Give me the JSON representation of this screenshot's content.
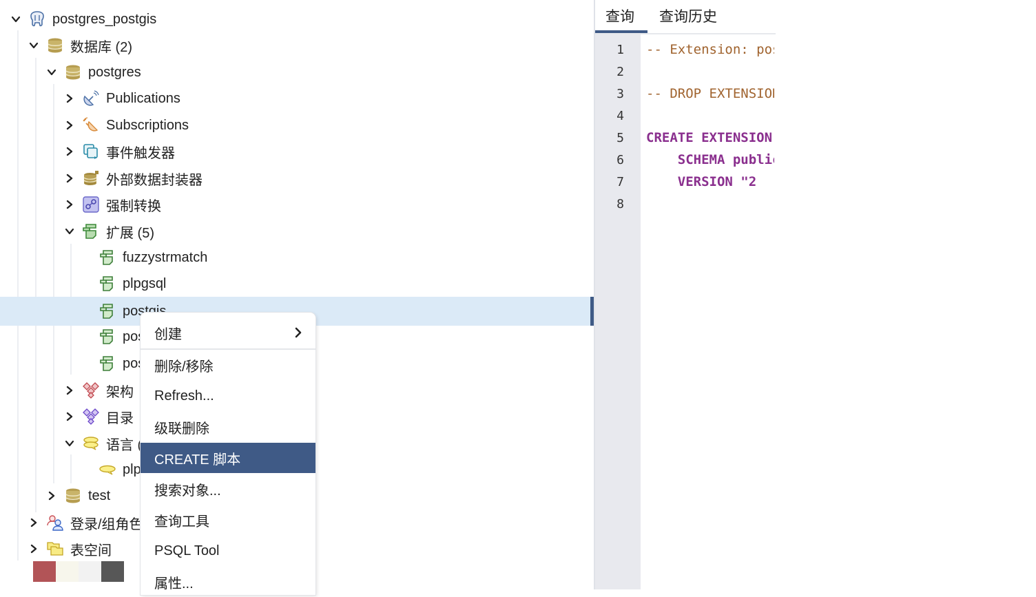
{
  "tree": {
    "items": [
      {
        "label": "postgres_postgis",
        "icon": "postgres-elephant-icon",
        "expanded": true
      },
      {
        "label": "数据库 (2)",
        "icon": "databases-icon",
        "expanded": true
      },
      {
        "label": "postgres",
        "icon": "database-icon",
        "expanded": true
      },
      {
        "label": "Publications",
        "icon": "publication-icon",
        "expanded": false
      },
      {
        "label": "Subscriptions",
        "icon": "subscription-icon",
        "expanded": false
      },
      {
        "label": "事件触发器",
        "icon": "event-trigger-icon",
        "expanded": false
      },
      {
        "label": "外部数据封装器",
        "icon": "foreign-data-wrapper-icon",
        "expanded": false
      },
      {
        "label": "强制转换",
        "icon": "cast-icon",
        "expanded": false
      },
      {
        "label": "扩展 (5)",
        "icon": "extensions-icon",
        "expanded": true
      },
      {
        "label": "fuzzystrmatch",
        "icon": "extension-icon"
      },
      {
        "label": "plpgsql",
        "icon": "extension-icon"
      },
      {
        "label": "postgis",
        "icon": "extension-icon",
        "selected": true
      },
      {
        "label": "pos",
        "icon": "extension-icon"
      },
      {
        "label": "pos",
        "icon": "extension-icon"
      },
      {
        "label": "架构",
        "icon": "schema-icon",
        "expanded": false
      },
      {
        "label": "目录",
        "icon": "catalog-icon",
        "expanded": false
      },
      {
        "label": "语言 (",
        "icon": "languages-icon",
        "expanded": true
      },
      {
        "label": "plp",
        "icon": "language-icon"
      },
      {
        "label": "test",
        "icon": "database-icon",
        "expanded": false
      },
      {
        "label": "登录/组角色",
        "icon": "login-roles-icon",
        "expanded": false
      },
      {
        "label": "表空间",
        "icon": "tablespaces-icon",
        "expanded": false
      }
    ],
    "swatches": [
      "#b25457",
      "#f7f6ec",
      "#f2f2f2",
      "#575757"
    ]
  },
  "query_panel": {
    "tabs": [
      {
        "label": "查询",
        "active": true
      },
      {
        "label": "查询历史",
        "active": false
      }
    ],
    "lines": [
      {
        "n": "1",
        "text": "-- Extension: postgis",
        "kind": "comment"
      },
      {
        "n": "2",
        "text": "",
        "kind": "plain"
      },
      {
        "n": "3",
        "text": "-- DROP EXTENSION postgis;",
        "kind": "comment"
      },
      {
        "n": "4",
        "text": "",
        "kind": "plain"
      },
      {
        "n": "5",
        "text": "CREATE EXTENSION IF NOT EXISTS postgis",
        "kind": "keyword"
      },
      {
        "n": "6",
        "text": "    SCHEMA public",
        "kind": "keyword"
      },
      {
        "n": "7",
        "text": "    VERSION \"2",
        "kind": "keyword"
      },
      {
        "n": "8",
        "text": "",
        "kind": "plain"
      }
    ]
  },
  "context_menu": {
    "items": [
      {
        "label": "创建",
        "submenu": true
      },
      {
        "label": "删除/移除"
      },
      {
        "label": "Refresh..."
      },
      {
        "label": "级联删除"
      },
      {
        "label": "CREATE 脚本",
        "active": true
      },
      {
        "label": "搜索对象..."
      },
      {
        "label": "查询工具"
      },
      {
        "label": "PSQL Tool"
      },
      {
        "label": "属性..."
      }
    ]
  },
  "colors": {
    "accent": "#3f5a86",
    "selection": "#dbeaf7",
    "comment": "#a0632e",
    "keyword": "#8a2f8e"
  }
}
